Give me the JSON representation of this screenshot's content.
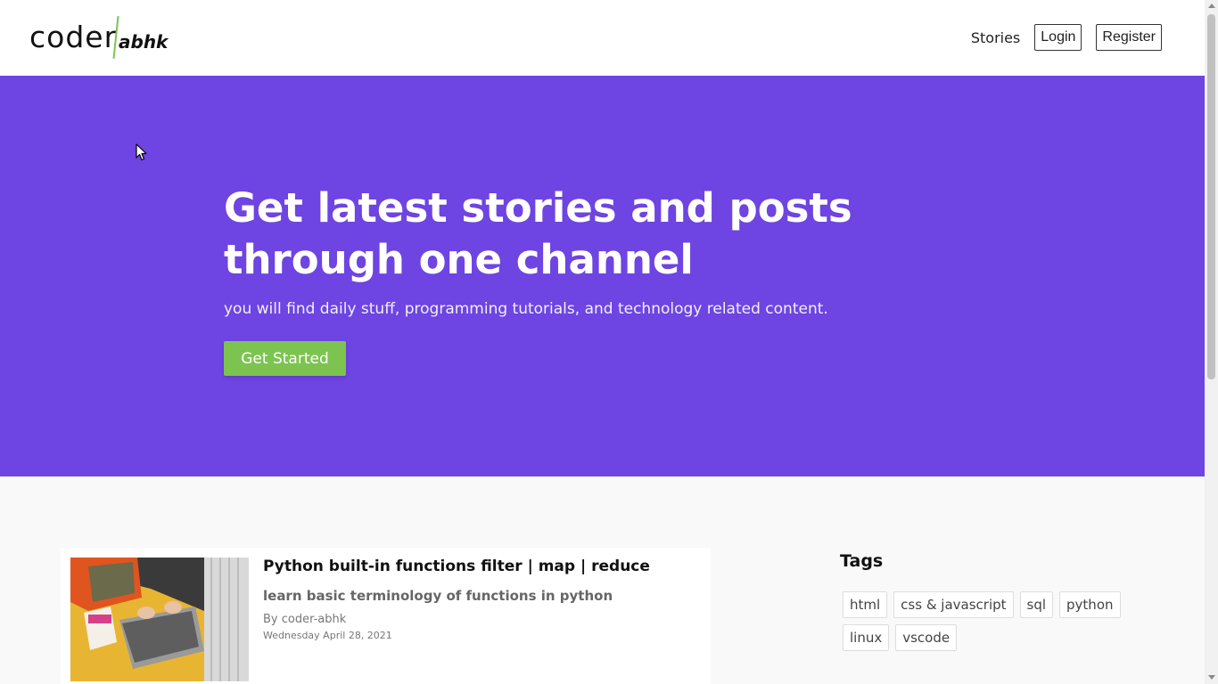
{
  "navbar": {
    "logo_main": "coder",
    "logo_sub": "abhk",
    "links": {
      "stories": "Stories",
      "login": "Login",
      "register": "Register"
    }
  },
  "hero": {
    "title": "Get latest stories and posts through one channel",
    "subtitle": "you will find daily stuff, programming tutorials, and technology related content.",
    "cta": "Get Started"
  },
  "post": {
    "title": "Python built-in functions filter | map | reduce",
    "description": "learn basic terminology of functions in python",
    "author": "By coder-abhk",
    "date": "Wednesday April 28, 2021"
  },
  "tags": {
    "title": "Tags",
    "items": [
      "html",
      "css & javascript",
      "sql",
      "python",
      "linux",
      "vscode"
    ]
  },
  "colors": {
    "hero_bg": "#6e44e2",
    "accent_green": "#7cc44f"
  }
}
